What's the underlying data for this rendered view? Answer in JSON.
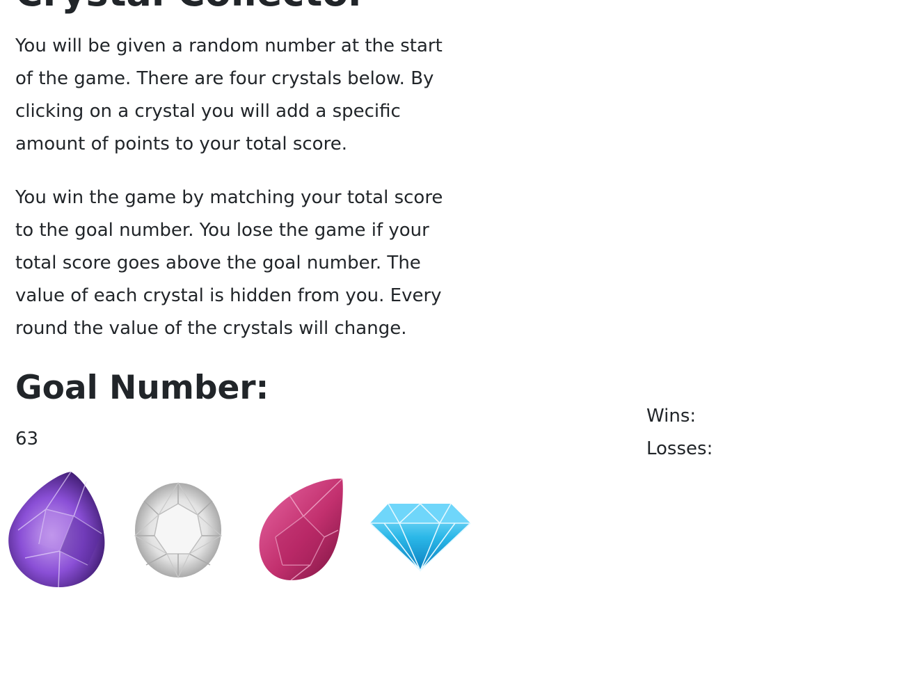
{
  "game": {
    "title": "Crystal Collector",
    "instructions": [
      "You will be given a random number at the start of the game. There are four crystals below. By clicking on a crystal you will add a specific amount of points to your total score.",
      "You win the game by matching your total score to the goal number. You lose the game if your total score goes above the goal number. The value of each crystal is hidden from you. Every round the value of the crystals will change."
    ],
    "goal_heading": "Goal Number:",
    "goal_value": "63"
  },
  "crystals": [
    {
      "name": "purple-crystal",
      "color": "#7b3fc4"
    },
    {
      "name": "white-crystal",
      "color": "#d9d9d9"
    },
    {
      "name": "pink-crystal",
      "color": "#c2306e"
    },
    {
      "name": "blue-crystal",
      "color": "#2bb8e8"
    }
  ],
  "scoreboard": {
    "wins_label": "Wins:",
    "losses_label": "Losses:"
  }
}
